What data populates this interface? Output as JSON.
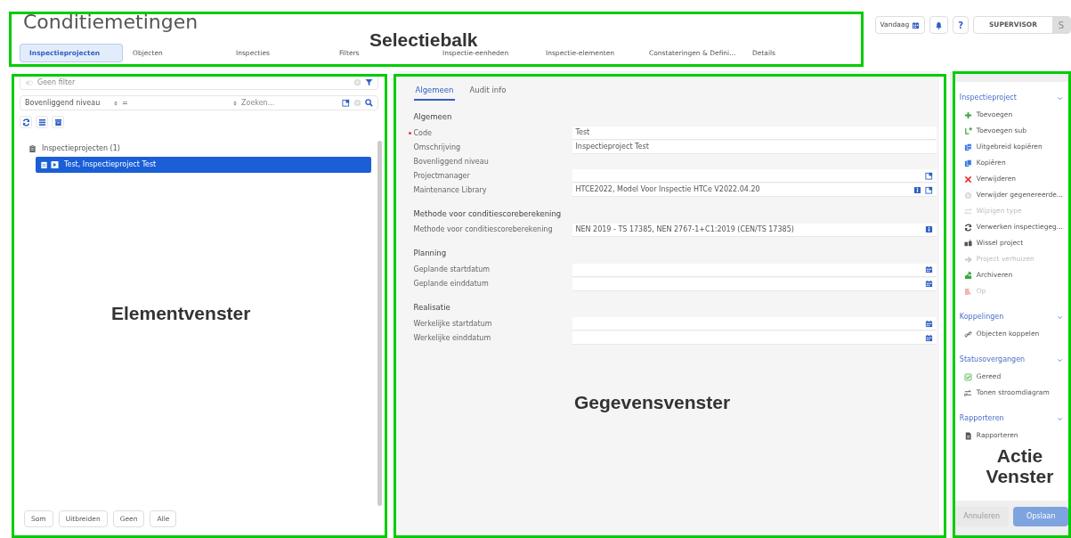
{
  "header": {
    "title": "Conditiemetingen",
    "tabs": [
      {
        "label": "Inspectieprojecten",
        "selected": true
      },
      {
        "label": "Objecten",
        "selected": false
      },
      {
        "label": "Inspecties",
        "selected": false
      },
      {
        "label": "Filters",
        "selected": false
      },
      {
        "label": "Inspectie-eenheden",
        "selected": false
      },
      {
        "label": "Inspectie-elementen",
        "selected": false
      },
      {
        "label": "Constateringen & Defini...",
        "selected": false
      },
      {
        "label": "Details",
        "selected": false
      }
    ],
    "today_button": "Vandaag",
    "help_button": "?",
    "user": "SUPERVISOR",
    "user_initial": "S"
  },
  "element_panel": {
    "filter_placeholder": "Geen filter",
    "level_select": "Bovenliggend niveau",
    "operator": "=",
    "search_placeholder": "Zoeken...",
    "tree": [
      {
        "label": "Inspectieprojecten (1)",
        "children": [
          {
            "label": "Test, Inspectieproject Test",
            "selected": true
          }
        ]
      }
    ],
    "footer_buttons": [
      "Som",
      "Uitbreiden",
      "Geen",
      "Alle"
    ]
  },
  "data_panel": {
    "tabs": [
      {
        "label": "Algemeen",
        "selected": true
      },
      {
        "label": "Audit info",
        "selected": false
      }
    ],
    "sections": [
      {
        "title": "Algemeen",
        "fields": [
          {
            "label": "Code",
            "required": true,
            "kind": "text",
            "value": "Test"
          },
          {
            "label": "Omschrijving",
            "required": false,
            "kind": "text",
            "value": "Inspectieproject Test"
          },
          {
            "label": "Bovenliggend niveau",
            "required": false,
            "kind": "empty"
          },
          {
            "label": "Projectmanager",
            "required": false,
            "kind": "lookup"
          },
          {
            "label": "Maintenance Library",
            "required": false,
            "kind": "lookup-info",
            "value": "HTCE2022, Model Voor Inspectie HTCe V2022.04.20"
          }
        ]
      },
      {
        "title": "Methode voor conditiescoreberekening",
        "fields": [
          {
            "label": "Methode voor conditiescoreberekening",
            "required": false,
            "kind": "info",
            "value": "NEN 2019 - TS 17385, NEN 2767-1+C1:2019 (CEN/TS 17385)"
          }
        ]
      },
      {
        "title": "Planning",
        "fields": [
          {
            "label": "Geplande startdatum",
            "required": false,
            "kind": "date"
          },
          {
            "label": "Geplande einddatum",
            "required": false,
            "kind": "date"
          }
        ]
      },
      {
        "title": "Realisatie",
        "fields": [
          {
            "label": "Werkelijke startdatum",
            "required": false,
            "kind": "date"
          },
          {
            "label": "Werkelijke einddatum",
            "required": false,
            "kind": "date"
          }
        ]
      }
    ]
  },
  "action_panel": {
    "groups": [
      {
        "title": "Inspectieproject",
        "items": [
          {
            "label": "Toevoegen",
            "kind": "add",
            "disabled": false
          },
          {
            "label": "Toevoegen sub",
            "kind": "add-sub",
            "disabled": false
          },
          {
            "label": "Uitgebreid kopiëren",
            "kind": "copy-extended",
            "disabled": false
          },
          {
            "label": "Kopiëren",
            "kind": "copy",
            "disabled": false
          },
          {
            "label": "Verwijderen",
            "kind": "delete",
            "disabled": false
          },
          {
            "label": "Verwijder gegenereerde...",
            "kind": "remove",
            "disabled": false
          },
          {
            "label": "Wijzigen type",
            "kind": "swap",
            "disabled": true
          },
          {
            "label": "Verwerken inspectiegeg...",
            "kind": "process",
            "disabled": false
          },
          {
            "label": "Wissel project",
            "kind": "switch",
            "disabled": false
          },
          {
            "label": "Project verhuizen",
            "kind": "move",
            "disabled": true
          },
          {
            "label": "Archiveren",
            "kind": "archive",
            "disabled": false
          },
          {
            "label": "Op",
            "kind": "unarchive",
            "disabled": true
          }
        ]
      },
      {
        "title": "Koppelingen",
        "items": [
          {
            "label": "Objecten koppelen",
            "kind": "link",
            "disabled": false
          }
        ]
      },
      {
        "title": "Statusovergangen",
        "items": [
          {
            "label": "Gereed",
            "kind": "done",
            "disabled": false
          },
          {
            "label": "Tonen stroomdiagram",
            "kind": "flow",
            "disabled": false
          }
        ]
      },
      {
        "title": "Rapporteren",
        "items": [
          {
            "label": "Rapporteren",
            "kind": "report",
            "disabled": false
          }
        ]
      }
    ],
    "buttons": [
      {
        "label": "Annuleren",
        "kind": "secondary"
      },
      {
        "label": "Opslaan",
        "kind": "primary"
      }
    ]
  },
  "annotations": [
    {
      "label": "Selectiebalk"
    },
    {
      "label": "Elementvenster"
    },
    {
      "label": "Gegevensvenster"
    },
    {
      "label": "Actie Venster"
    }
  ]
}
